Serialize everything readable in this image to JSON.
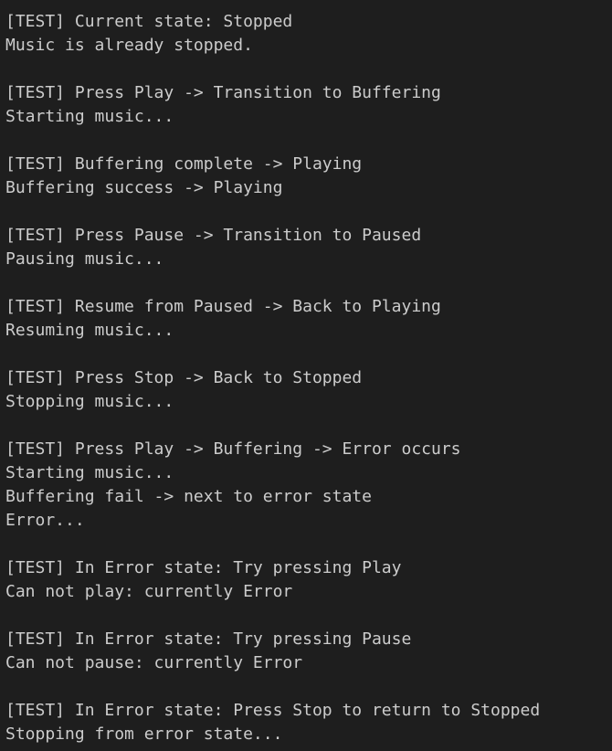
{
  "colors": {
    "background": "#1e1e1e",
    "text": "#cccccc"
  },
  "terminal": {
    "lines": [
      "[TEST] Current state: Stopped",
      "Music is already stopped.",
      "",
      "[TEST] Press Play -> Transition to Buffering",
      "Starting music...",
      "",
      "[TEST] Buffering complete -> Playing",
      "Buffering success -> Playing",
      "",
      "[TEST] Press Pause -> Transition to Paused",
      "Pausing music...",
      "",
      "[TEST] Resume from Paused -> Back to Playing",
      "Resuming music...",
      "",
      "[TEST] Press Stop -> Back to Stopped",
      "Stopping music...",
      "",
      "[TEST] Press Play -> Buffering -> Error occurs",
      "Starting music...",
      "Buffering fail -> next to error state",
      "Error...",
      "",
      "[TEST] In Error state: Try pressing Play",
      "Can not play: currently Error",
      "",
      "[TEST] In Error state: Try pressing Pause",
      "Can not pause: currently Error",
      "",
      "[TEST] In Error state: Press Stop to return to Stopped",
      "Stopping from error state..."
    ]
  }
}
